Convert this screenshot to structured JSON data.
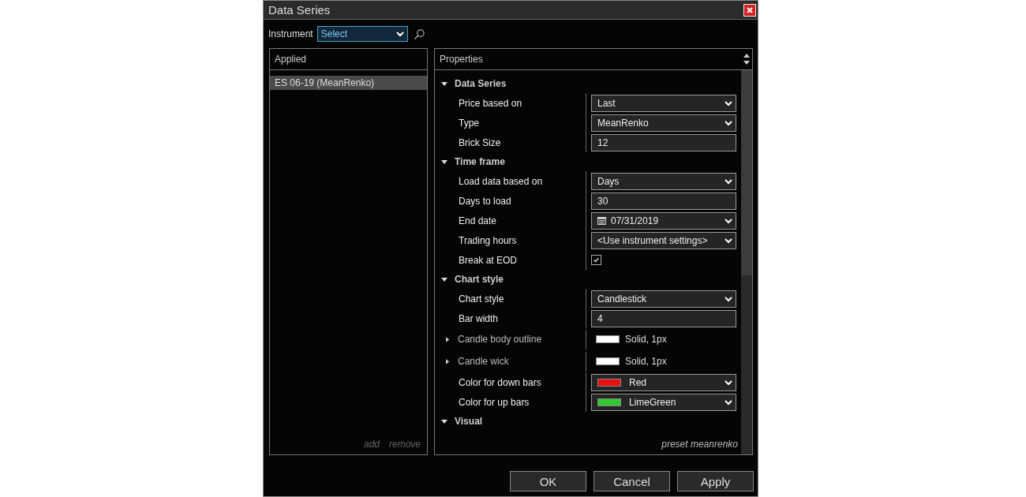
{
  "window": {
    "title": "Data Series"
  },
  "instrument": {
    "label": "Instrument",
    "value": "Select"
  },
  "applied": {
    "header": "Applied",
    "items": [
      {
        "label": "ES 06-19 (MeanRenko)",
        "selected": true
      }
    ],
    "actions": [
      "add",
      "remove"
    ]
  },
  "properties": {
    "header": "Properties",
    "sections": [
      {
        "title": "Data Series",
        "expanded": true,
        "rows": [
          {
            "kind": "select",
            "label": "Price based on",
            "value": "Last"
          },
          {
            "kind": "select",
            "label": "Type",
            "value": "MeanRenko"
          },
          {
            "kind": "text",
            "label": "Brick Size",
            "value": "12"
          }
        ]
      },
      {
        "title": "Time frame",
        "expanded": true,
        "rows": [
          {
            "kind": "select",
            "label": "Load data based on",
            "value": "Days"
          },
          {
            "kind": "text",
            "label": "Days to load",
            "value": "30"
          },
          {
            "kind": "date",
            "label": "End date",
            "value": "07/31/2019"
          },
          {
            "kind": "select",
            "label": "Trading hours",
            "value": "<Use instrument settings>"
          },
          {
            "kind": "checkbox",
            "label": "Break at EOD",
            "checked": true
          }
        ]
      },
      {
        "title": "Chart style",
        "expanded": true,
        "rows": [
          {
            "kind": "select",
            "label": "Chart style",
            "value": "Candlestick"
          },
          {
            "kind": "text",
            "label": "Bar width",
            "value": "4"
          },
          {
            "kind": "stroke",
            "label": "Candle body outline",
            "value": "Solid, 1px",
            "color": "#ffffff",
            "expanded": false
          },
          {
            "kind": "stroke",
            "label": "Candle wick",
            "value": "Solid, 1px",
            "color": "#ffffff",
            "expanded": false
          },
          {
            "kind": "color",
            "label": "Color for down bars",
            "value": "Red",
            "color": "#e81010"
          },
          {
            "kind": "color",
            "label": "Color for up bars",
            "value": "LimeGreen",
            "color": "#32c832"
          }
        ]
      },
      {
        "title": "Visual",
        "expanded": true
      }
    ],
    "preset": "preset meanrenko"
  },
  "buttons": [
    "OK",
    "Cancel",
    "Apply"
  ]
}
